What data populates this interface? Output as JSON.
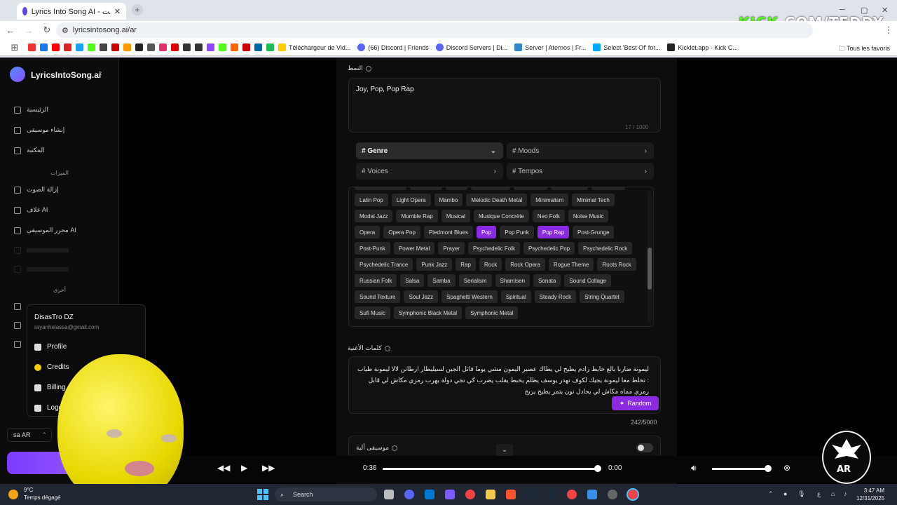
{
  "browser": {
    "tab_title": "Lyrics Into Song AI - مولد الأغاني عبر الإنترنت",
    "url": "lyricsintosong.ai/ar",
    "overlay_watermark_prefix": "KICK",
    "overlay_watermark_suffix": ".COM/TEDDY-OMG",
    "bookmarks": [
      "Téléchargeur de Vid...",
      "(66) Discord | Friends",
      "Discord Servers | Di...",
      "Server | Aternos | Fr...",
      "Select 'Best Of' for...",
      "Kicklet.app - Kick C..."
    ],
    "all_bookmarks": "Tous les favoris"
  },
  "sidebar": {
    "brand": "LyricsIntoSong.ai",
    "items": [
      {
        "label": "الرئيسية",
        "icon": "home-icon"
      },
      {
        "label": "إنشاء موسيقى",
        "icon": "music-icon"
      },
      {
        "label": "المكتبة",
        "icon": "library-icon"
      }
    ],
    "section_features": "الميزات",
    "features": [
      {
        "label": "إزالة الصوت",
        "icon": "wand-icon"
      },
      {
        "label": "غلاف AI",
        "icon": "waveform-icon"
      },
      {
        "label": "محرر الموسيقى AI",
        "icon": "editor-icon"
      }
    ],
    "section_other": "أخرى",
    "language": "AR",
    "language_prefix": "sa"
  },
  "user_menu": {
    "name": "DisasTro DZ",
    "email": "rayanhelassa@gmail.com",
    "items": [
      "Profile",
      "Credits",
      "Billing",
      "Logout"
    ]
  },
  "form": {
    "style_label": "النمط",
    "style_value": "Joy, Pop, Pop Rap",
    "style_count": "17 / 1000",
    "dropdowns": [
      {
        "label": "# Genre",
        "expanded": true
      },
      {
        "label": "# Moods",
        "expanded": false
      },
      {
        "label": "# Voices",
        "expanded": false
      },
      {
        "label": "# Tempos",
        "expanded": false
      }
    ],
    "tags": [
      {
        "label": "Intelligent Dance",
        "selected": false
      },
      {
        "label": "Irish Folk",
        "selected": false
      },
      {
        "label": "Jazz",
        "selected": false
      },
      {
        "label": "Jazz Fusion",
        "selected": false
      },
      {
        "label": "Jazz Rap",
        "selected": false
      },
      {
        "label": "Kayokyoku",
        "selected": false
      },
      {
        "label": "Latin Folk",
        "selected": false
      },
      {
        "label": "Latin Pop",
        "selected": false
      },
      {
        "label": "Light Opera",
        "selected": false
      },
      {
        "label": "Mambo",
        "selected": false
      },
      {
        "label": "Melodic Death Metal",
        "selected": false
      },
      {
        "label": "Minimalism",
        "selected": false
      },
      {
        "label": "Minimal Tech",
        "selected": false
      },
      {
        "label": "Modal Jazz",
        "selected": false
      },
      {
        "label": "Mumble Rap",
        "selected": false
      },
      {
        "label": "Musical",
        "selected": false
      },
      {
        "label": "Musique Concrète",
        "selected": false
      },
      {
        "label": "Neo Folk",
        "selected": false
      },
      {
        "label": "Noise Music",
        "selected": false
      },
      {
        "label": "Opera",
        "selected": false
      },
      {
        "label": "Opera Pop",
        "selected": false
      },
      {
        "label": "Piedmont Blues",
        "selected": false
      },
      {
        "label": "Pop",
        "selected": true
      },
      {
        "label": "Pop Punk",
        "selected": false
      },
      {
        "label": "Pop Rap",
        "selected": true
      },
      {
        "label": "Post-Grunge",
        "selected": false
      },
      {
        "label": "Post-Punk",
        "selected": false
      },
      {
        "label": "Power Metal",
        "selected": false
      },
      {
        "label": "Prayer",
        "selected": false
      },
      {
        "label": "Psychedelic Folk",
        "selected": false
      },
      {
        "label": "Psychedelic Pop",
        "selected": false
      },
      {
        "label": "Psychedelic Rock",
        "selected": false
      },
      {
        "label": "Psychedelic Trance",
        "selected": false
      },
      {
        "label": "Punk Jazz",
        "selected": false
      },
      {
        "label": "Rap",
        "selected": false
      },
      {
        "label": "Rock",
        "selected": false
      },
      {
        "label": "Rock Opera",
        "selected": false
      },
      {
        "label": "Rogue Theme",
        "selected": false
      },
      {
        "label": "Roots Rock",
        "selected": false
      },
      {
        "label": "Russian Folk",
        "selected": false
      },
      {
        "label": "Salsa",
        "selected": false
      },
      {
        "label": "Samba",
        "selected": false
      },
      {
        "label": "Serialism",
        "selected": false
      },
      {
        "label": "Shamisen",
        "selected": false
      },
      {
        "label": "Sonata",
        "selected": false
      },
      {
        "label": "Sound Collage",
        "selected": false
      },
      {
        "label": "Sound Texture",
        "selected": false
      },
      {
        "label": "Soul Jazz",
        "selected": false
      },
      {
        "label": "Spaghetti Western",
        "selected": false
      },
      {
        "label": "Spiritual",
        "selected": false
      },
      {
        "label": "Steady Rock",
        "selected": false
      },
      {
        "label": "String Quartet",
        "selected": false
      },
      {
        "label": "Sufi Music",
        "selected": false
      },
      {
        "label": "Symphonic Black Metal",
        "selected": false
      },
      {
        "label": "Symphonic Metal",
        "selected": false
      }
    ],
    "lyrics_label": "كلمات الأغنية",
    "lyrics_value": "ليمونة ضاربا بالع خابط زادم يطيح لي يطاك عصير اليمون مشي يوما قاثل الجين لسيليطار ارطاتن لالا ليمونة طياب : تخلط معا ليمونة يجيك لكوف تهدر يوسف يظلم يخبط يقلب يضرب كي تجي دولة يهرب رمزي مكاش لي قابل رمزي مماه مكاش لي يجادل نون يتمر يطيح يربح",
    "random_label": "Random",
    "lyrics_count": "242/5000",
    "instrumental_label": "موسيقى آلية",
    "instrumental_enabled": false
  },
  "player": {
    "current_time": "0:36",
    "end_time": "0:00",
    "progress_fraction": 0.99,
    "volume_fraction": 1.0
  },
  "taskbar": {
    "temperature": "9°C",
    "weather": "Temps dégagé",
    "search": "Search",
    "time": "3:47 AM",
    "date": "12/31/2025",
    "input_lang": "ع"
  },
  "colors": {
    "accent": "#8a2be2",
    "background": "#000000",
    "lemon": "#f3e400"
  }
}
